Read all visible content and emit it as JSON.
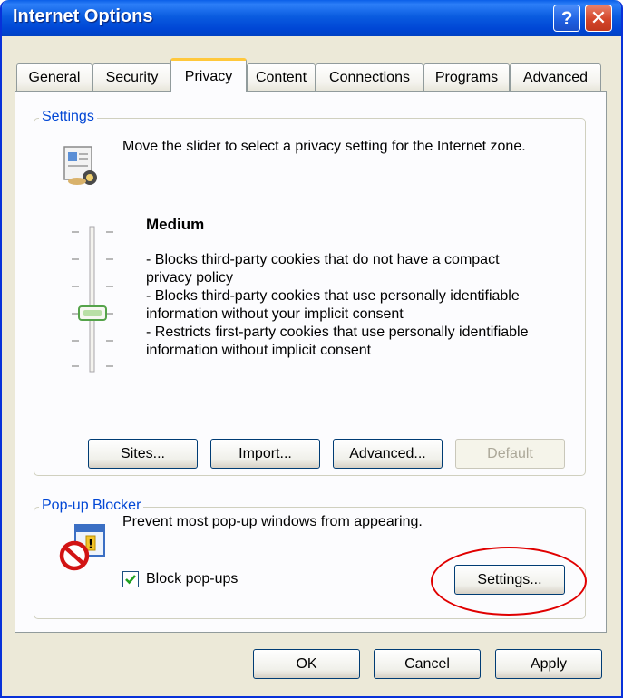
{
  "window": {
    "title": "Internet Options",
    "help_glyph": "?",
    "close_glyph": "✕"
  },
  "tabs": [
    {
      "label": "General"
    },
    {
      "label": "Security"
    },
    {
      "label": "Privacy"
    },
    {
      "label": "Content"
    },
    {
      "label": "Connections"
    },
    {
      "label": "Programs"
    },
    {
      "label": "Advanced"
    }
  ],
  "active_tab": "Privacy",
  "settings_group": {
    "legend": "Settings",
    "description": "Move the slider to select a privacy setting for the Internet zone.",
    "level_title": "Medium",
    "level_lines": [
      "- Blocks third-party cookies that do not have a compact",
      "privacy policy",
      "- Blocks third-party cookies that use personally identifiable",
      "information without your implicit consent",
      "- Restricts first-party cookies that use personally identifiable",
      "information without implicit consent"
    ],
    "slider_level": 3,
    "slider_levels_total": 6,
    "buttons": {
      "sites": "Sites...",
      "import": "Import...",
      "advanced": "Advanced...",
      "default": "Default"
    }
  },
  "popup_group": {
    "legend": "Pop-up Blocker",
    "description": "Prevent most pop-up windows from appearing.",
    "checkbox_label": "Block pop-ups",
    "checkbox_checked": true,
    "settings_button": "Settings..."
  },
  "footer": {
    "ok": "OK",
    "cancel": "Cancel",
    "apply": "Apply"
  },
  "colors": {
    "titlebar": "#0054e3",
    "group_legend": "#0046d5",
    "highlight_ellipse": "#e00000"
  }
}
